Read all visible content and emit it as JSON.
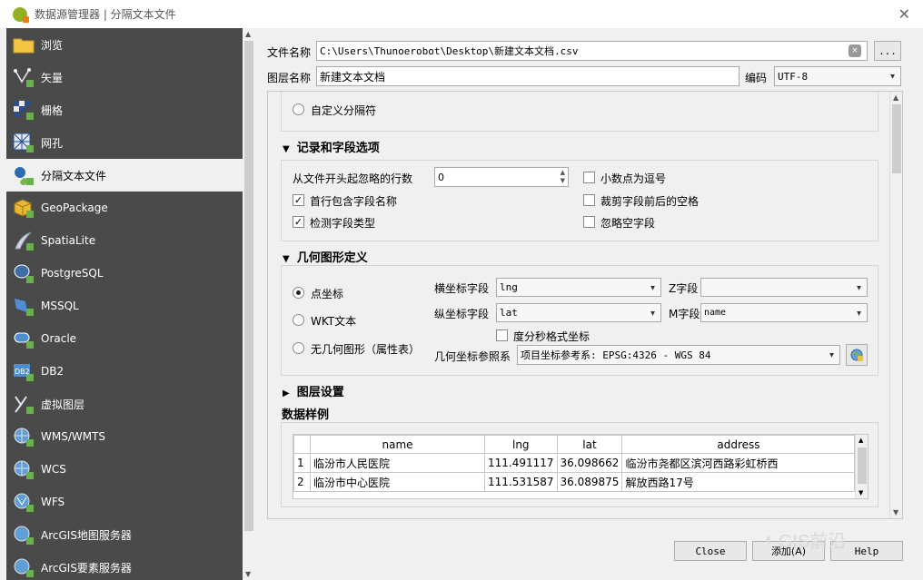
{
  "window": {
    "title": "数据源管理器 | 分隔文本文件",
    "close_glyph": "✕"
  },
  "sidebar": {
    "items": [
      {
        "label": "浏览",
        "icon": "folder-icon",
        "active": false
      },
      {
        "label": "矢量",
        "icon": "vector-add-icon",
        "active": false
      },
      {
        "label": "栅格",
        "icon": "raster-add-icon",
        "active": false
      },
      {
        "label": "网孔",
        "icon": "mesh-add-icon",
        "active": false
      },
      {
        "label": "分隔文本文件",
        "icon": "delimited-text-icon",
        "active": true
      },
      {
        "label": "GeoPackage",
        "icon": "geopackage-icon",
        "active": false
      },
      {
        "label": "SpatiaLite",
        "icon": "spatialite-icon",
        "active": false
      },
      {
        "label": "PostgreSQL",
        "icon": "postgresql-icon",
        "active": false
      },
      {
        "label": "MSSQL",
        "icon": "mssql-icon",
        "active": false
      },
      {
        "label": "Oracle",
        "icon": "oracle-icon",
        "active": false
      },
      {
        "label": "DB2",
        "icon": "db2-icon",
        "active": false
      },
      {
        "label": "虚拟图层",
        "icon": "virtual-layer-icon",
        "active": false
      },
      {
        "label": "WMS/WMTS",
        "icon": "wms-icon",
        "active": false
      },
      {
        "label": "WCS",
        "icon": "wcs-icon",
        "active": false
      },
      {
        "label": "WFS",
        "icon": "wfs-icon",
        "active": false
      },
      {
        "label": "ArcGIS地图服务器",
        "icon": "arcgis-map-icon",
        "active": false
      },
      {
        "label": "ArcGIS要素服务器",
        "icon": "arcgis-feature-icon",
        "active": false
      }
    ]
  },
  "file": {
    "label": "文件名称",
    "value": "C:\\Users\\Thunoerobot\\Desktop\\新建文本文档.csv",
    "browse": "..."
  },
  "layer": {
    "label": "图层名称",
    "value": "新建文本文档",
    "encoding_label": "编码",
    "encoding": "UTF-8"
  },
  "format": {
    "custom_delim": "自定义分隔符"
  },
  "records": {
    "title": "记录和字段选项",
    "skip_label": "从文件开头起忽略的行数",
    "skip_value": "0",
    "first_row_header": "首行包含字段名称",
    "detect_types": "检测字段类型",
    "decimal_comma": "小数点为逗号",
    "trim_fields": "裁剪字段前后的空格",
    "discard_empty": "忽略空字段"
  },
  "geometry": {
    "title": "几何图形定义",
    "point": "点坐标",
    "wkt": "WKT文本",
    "no_geom": "无几何图形（属性表）",
    "x_label": "横坐标字段",
    "x_value": "lng",
    "y_label": "纵坐标字段",
    "y_value": "lat",
    "z_label": "Z字段",
    "z_value": "",
    "m_label": "M字段",
    "m_value": "name",
    "dms": "度分秒格式坐标",
    "crs_label": "几何坐标参照系",
    "crs_value": "项目坐标参考系: EPSG:4326 - WGS 84"
  },
  "layer_settings": {
    "title": "图层设置"
  },
  "sample": {
    "title": "数据样例",
    "columns": [
      "name",
      "lng",
      "lat",
      "address"
    ],
    "rows": [
      {
        "n": "1",
        "cells": [
          "临汾市人民医院",
          "111.491117",
          "36.098662",
          "临汾市尧都区滨河西路彩虹桥西"
        ]
      },
      {
        "n": "2",
        "cells": [
          "临汾市中心医院",
          "111.531587",
          "36.089875",
          "解放西路17号"
        ]
      }
    ]
  },
  "buttons": {
    "close": "Close",
    "add": "添加(A)",
    "help": "Help"
  },
  "watermark": "GIS前沿"
}
